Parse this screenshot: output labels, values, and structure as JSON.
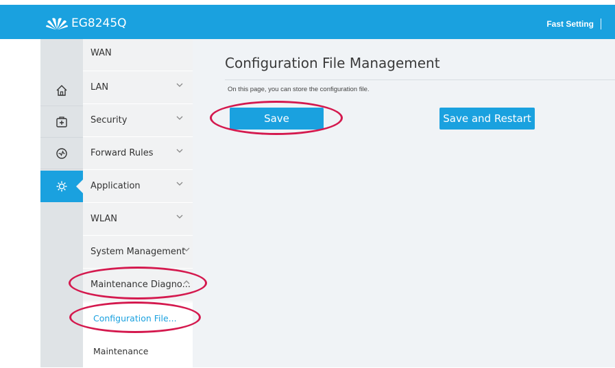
{
  "header": {
    "brand": "EG8245Q",
    "fast_setting": "Fast Setting",
    "logo_icon": "huawei-logo",
    "bar_color": "#1aa1df"
  },
  "nav_icons": [
    "home-icon",
    "tools-icon",
    "status-icon",
    "settings-icon"
  ],
  "menu": {
    "items": [
      {
        "label": "WAN"
      },
      {
        "label": "LAN"
      },
      {
        "label": "Security"
      },
      {
        "label": "Forward Rules"
      },
      {
        "label": "Application"
      },
      {
        "label": "WLAN"
      },
      {
        "label": "System Management"
      },
      {
        "label": "Maintenance Diagno..."
      }
    ],
    "submenu": [
      {
        "label": "Configuration File..."
      },
      {
        "label": "Maintenance"
      }
    ]
  },
  "main": {
    "title": "Configuration File Management",
    "description": "On this page, you can store the configuration file.",
    "save_label": "Save",
    "save_restart_label": "Save and Restart"
  },
  "colors": {
    "accent": "#1aa1df",
    "highlight_circle": "#d4194e"
  }
}
